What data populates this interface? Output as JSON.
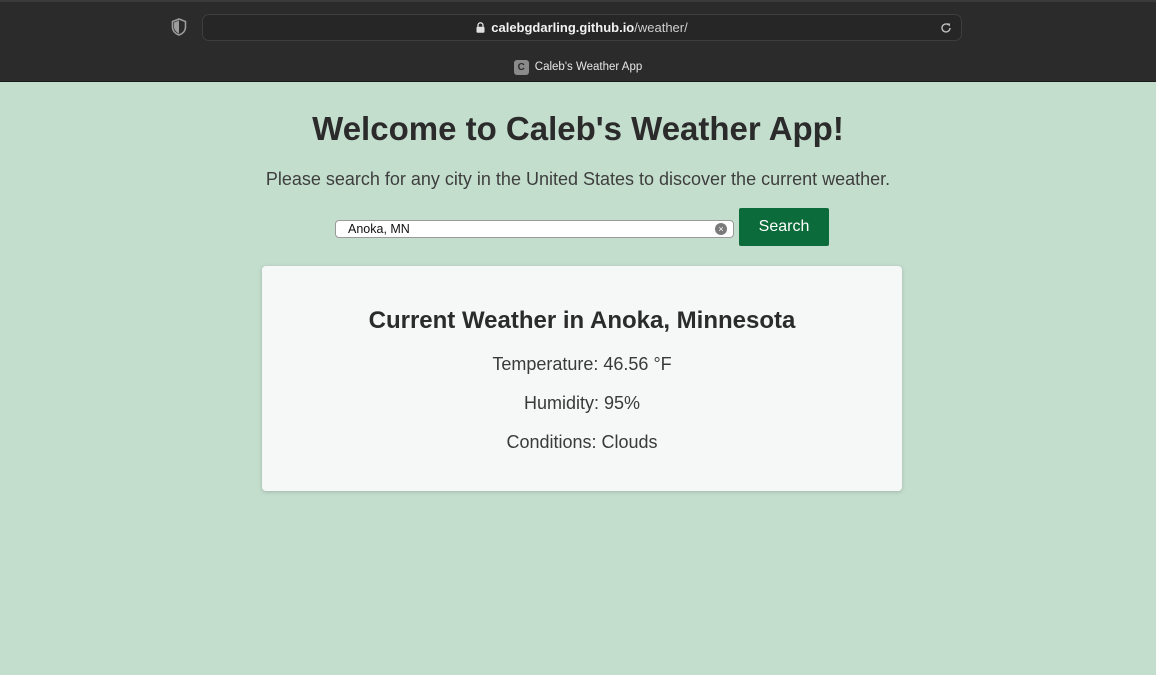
{
  "browser": {
    "url_host": "calebgdarling.github.io",
    "url_path": "/weather/",
    "tab_title": "Caleb's Weather App",
    "favicon_letter": "C"
  },
  "page": {
    "title": "Welcome to Caleb's Weather App!",
    "subtitle": "Please search for any city in the United States to discover the current weather."
  },
  "search": {
    "value": "Anoka, MN",
    "button_label": "Search"
  },
  "weather": {
    "heading": "Current Weather in Anoka, Minnesota",
    "temperature": "Temperature: 46.56 °F",
    "humidity": "Humidity: 95%",
    "conditions": "Conditions: Clouds"
  },
  "colors": {
    "page_background": "#c4dece",
    "accent_button": "#0c6b3b",
    "card_background": "#f6f8f8"
  },
  "icons": [
    "shield-icon",
    "lock-icon",
    "reload-icon",
    "clear-search-icon"
  ]
}
